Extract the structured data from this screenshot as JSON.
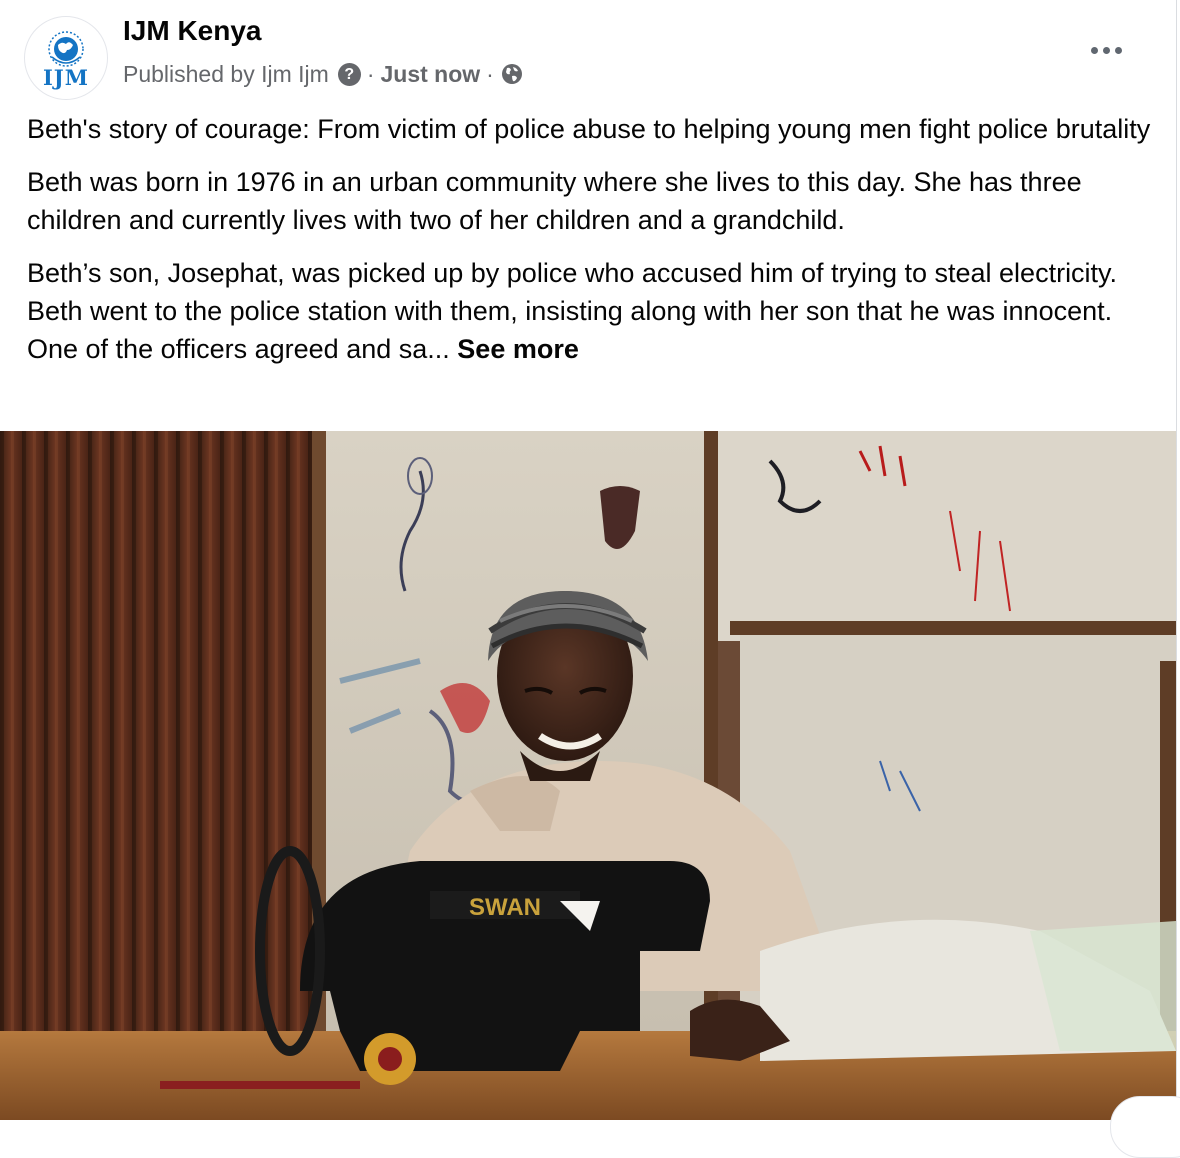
{
  "post": {
    "page_name": "IJM Kenya",
    "avatar_text": "IJM",
    "published_by": "Published by Ijm Ijm",
    "separator": "·",
    "timestamp": "Just now",
    "audience_icon": "globe-icon",
    "more_icon": "more-horizontal-icon",
    "help_icon": "question-icon",
    "help_glyph": "?",
    "paragraphs": [
      "Beth's story of courage: From victim of police abuse to helping young men fight police brutality",
      "Beth was born in 1976 in an urban community where she lives to this day. She has three children and currently lives with two of her children and a grandchild."
    ],
    "truncated_paragraph": "Beth’s son, Josephat, was picked up by police who accused him of trying to steal electricity. Beth went to the police station with them, insisting along with her son that he was innocent. One of the officers agreed and sa...",
    "see_more_label": "See more",
    "photo": {
      "machine_label": "SWAN"
    }
  },
  "colors": {
    "brand_blue": "#1474c4",
    "meta_gray": "#65676b"
  }
}
